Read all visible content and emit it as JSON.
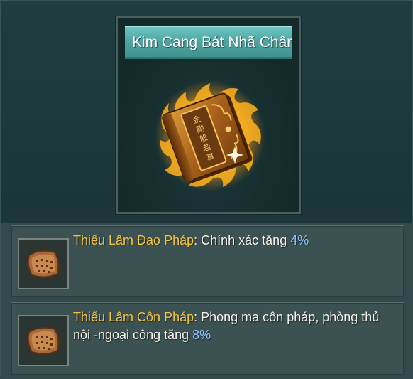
{
  "item": {
    "title": "Kim Cang Bát Nhã Chân Qu",
    "icon": "golden-scripture-book-icon"
  },
  "skills": [
    {
      "name": "Thiếu Lâm Đao Pháp",
      "separator": ": ",
      "description": "Chính xác tăng ",
      "value": "4%",
      "icon": "scroll-icon"
    },
    {
      "name": "Thiếu Lâm Côn Pháp",
      "separator": ": ",
      "description": "Phong ma côn pháp, phòng thủ nội -ngoại công tăng ",
      "value": "8%",
      "icon": "scroll-icon"
    }
  ],
  "colors": {
    "skill_name": "#f3c542",
    "skill_value": "#8fc3ff",
    "title_bar": "#4fa6a3",
    "panel_bg": "#1d3a3d"
  }
}
